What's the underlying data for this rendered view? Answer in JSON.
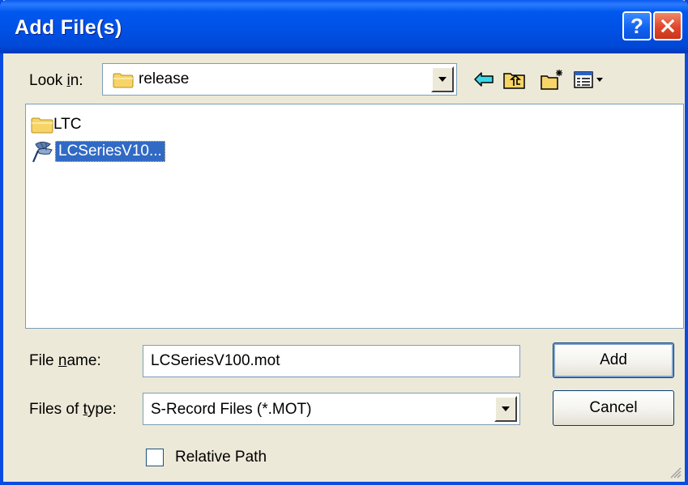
{
  "window": {
    "title": "Add File(s)",
    "help_label": "?"
  },
  "lookin": {
    "label_prefix": "Look ",
    "label_accel": "i",
    "label_suffix": "n:",
    "value": "release"
  },
  "toolbar": {
    "icons": [
      "back-arrow-icon",
      "up-folder-icon",
      "new-folder-icon",
      "view-menu-icon"
    ]
  },
  "files": [
    {
      "name": "LTC",
      "icon": "folder-icon",
      "selected": false
    },
    {
      "name": "LCSeriesV10...",
      "icon": "mot-file-icon",
      "selected": true
    }
  ],
  "filename": {
    "label_prefix": "File ",
    "label_accel": "n",
    "label_suffix": "ame:",
    "value": "LCSeriesV100.mot"
  },
  "filetype": {
    "label_prefix": "Files of ",
    "label_accel": "t",
    "label_suffix": "ype:",
    "value": "S-Record Files (*.MOT)"
  },
  "buttons": {
    "add": "Add",
    "cancel": "Cancel"
  },
  "relative_path": {
    "label": "Relative Path",
    "checked": false
  },
  "colors": {
    "title_blue": "#0054E3",
    "selection": "#316AC5",
    "dialog_bg": "#ECE9D8"
  }
}
